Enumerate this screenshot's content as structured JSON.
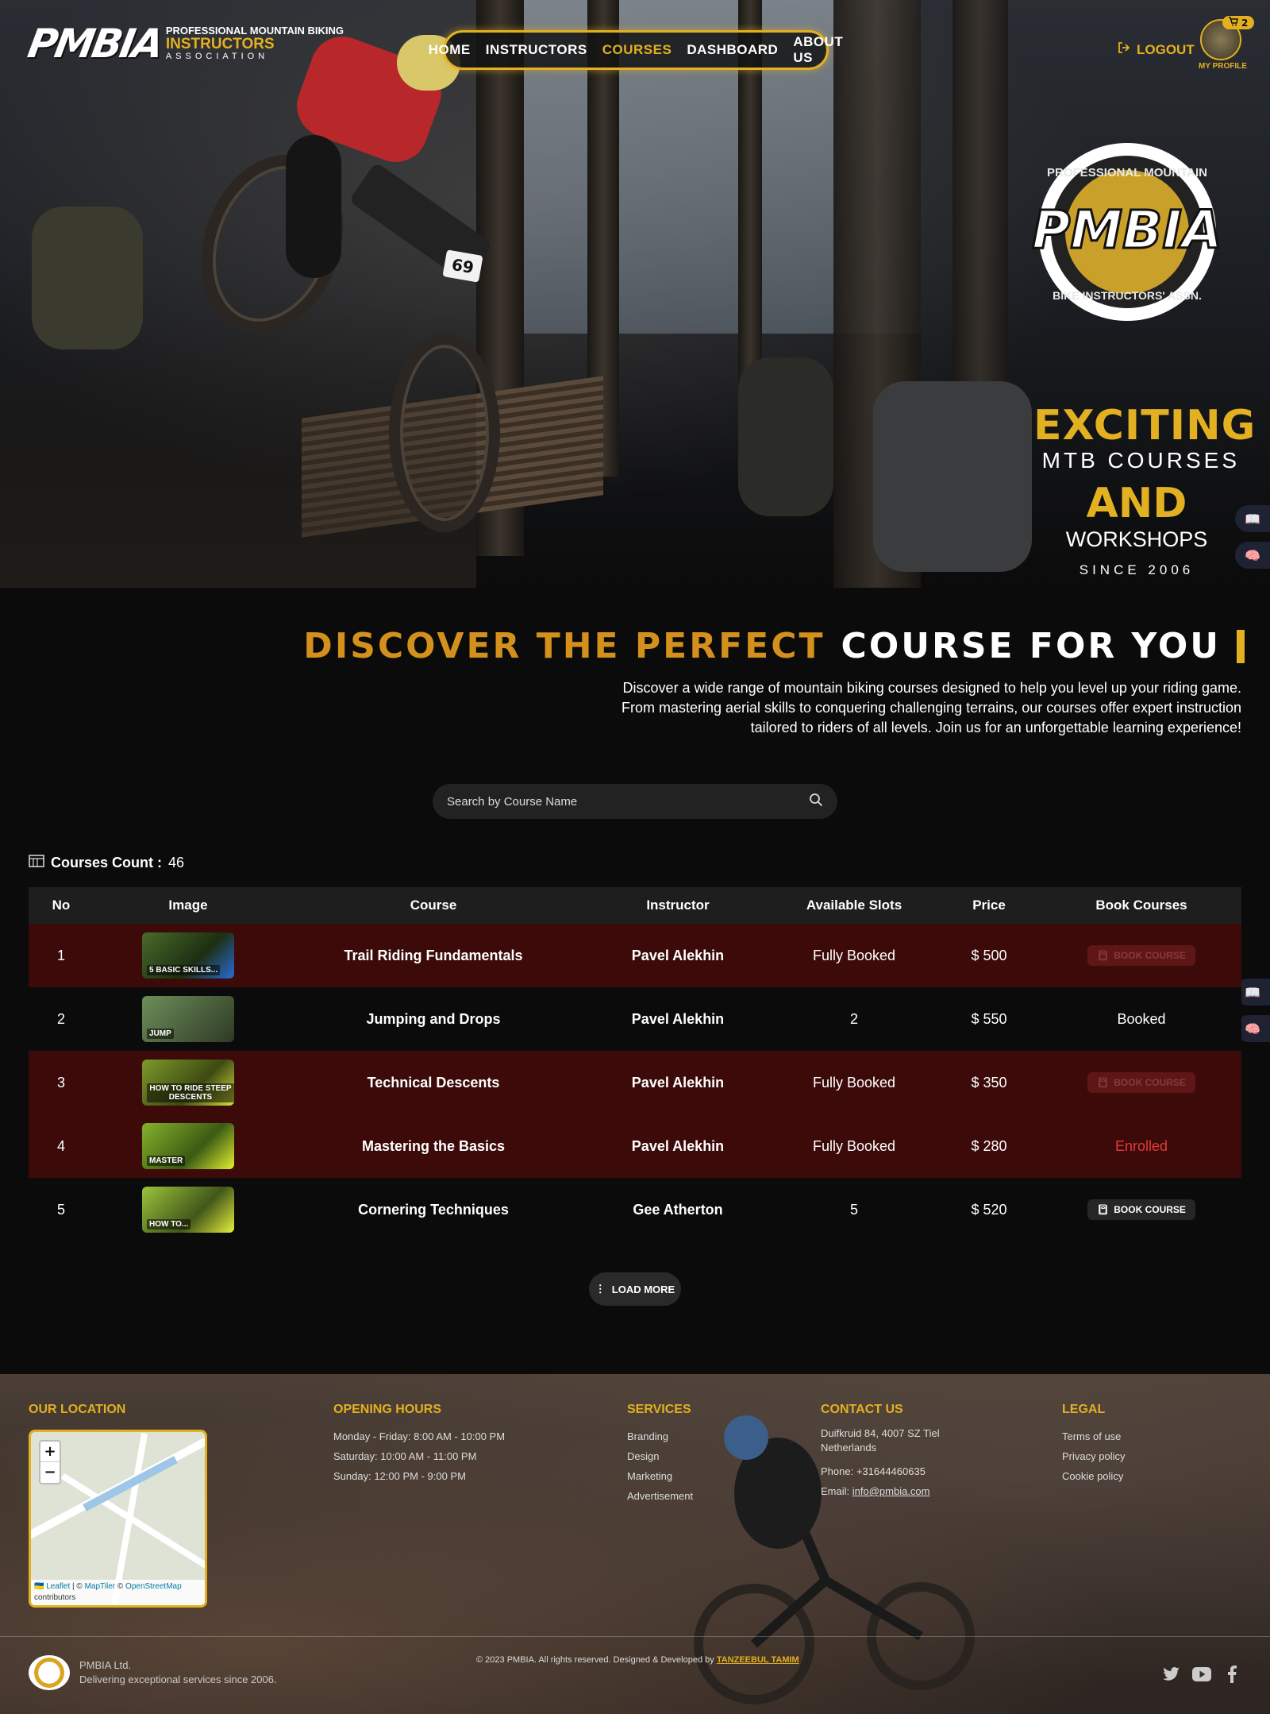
{
  "brand": {
    "logo_mark": "PMBIA",
    "line1": "PROFESSIONAL MOUNTAIN BIKING",
    "line2": "INSTRUCTORS",
    "line3": "ASSOCIATION",
    "accent": "#e3b021"
  },
  "nav": {
    "items": [
      {
        "label": "HOME",
        "active": false
      },
      {
        "label": "INSTRUCTORS",
        "active": false
      },
      {
        "label": "COURSES",
        "active": true
      },
      {
        "label": "DASHBOARD",
        "active": false
      },
      {
        "label": "ABOUT US",
        "active": false
      }
    ]
  },
  "header": {
    "logout_label": "LOGOUT",
    "profile_label": "MY PROFILE",
    "cart_count": "2"
  },
  "hero": {
    "badge_top": "PROFESSIONAL MOUNTAIN",
    "badge_bottom": "BIKE INSTRUCTORS' ASSN.",
    "badge_mark": "PMBIA",
    "rider_number": "69",
    "tagline": {
      "t1": "EXCITING",
      "t2": "MTB COURSES",
      "t3": "AND",
      "t4": "WORKSHOPS",
      "t5": "SINCE 2006"
    }
  },
  "discover": {
    "title_gold": "DISCOVER THE PERFECT",
    "title_white": "COURSE FOR YOU",
    "description": "Discover a wide range of mountain biking courses designed to help you level up your riding game. From mastering aerial skills to conquering challenging terrains, our courses offer expert instruction tailored to riders of all levels. Join us for an unforgettable learning experience!"
  },
  "search": {
    "placeholder": "Search by Course Name",
    "value": ""
  },
  "courses_count": {
    "label": "Courses Count :",
    "value": "46"
  },
  "table": {
    "headers": [
      "No",
      "Image",
      "Course",
      "Instructor",
      "Available Slots",
      "Price",
      "Book Courses"
    ],
    "rows": [
      {
        "no": "1",
        "thumb_text": "5 BASIC SKILLS...",
        "course": "Trail Riding Fundamentals",
        "instructor": "Pavel Alekhin",
        "slots": "Fully Booked",
        "price": "$ 500",
        "book": "BOOK COURSE",
        "book_state": "disabled",
        "highlight": true
      },
      {
        "no": "2",
        "thumb_text": "JUMP",
        "course": "Jumping and Drops",
        "instructor": "Pavel Alekhin",
        "slots": "2",
        "price": "$ 550",
        "book": "Booked",
        "book_state": "text",
        "highlight": false
      },
      {
        "no": "3",
        "thumb_text": "HOW TO RIDE STEEP DESCENTS",
        "course": "Technical Descents",
        "instructor": "Pavel Alekhin",
        "slots": "Fully Booked",
        "price": "$ 350",
        "book": "BOOK COURSE",
        "book_state": "disabled",
        "highlight": true
      },
      {
        "no": "4",
        "thumb_text": "MASTER",
        "course": "Mastering the Basics",
        "instructor": "Pavel Alekhin",
        "slots": "Fully Booked",
        "price": "$ 280",
        "book": "Enrolled",
        "book_state": "enrolled",
        "highlight": true
      },
      {
        "no": "5",
        "thumb_text": "HOW TO...",
        "course": "Cornering Techniques",
        "instructor": "Gee Atherton",
        "slots": "5",
        "price": "$ 520",
        "book": "BOOK COURSE",
        "book_state": "enabled",
        "highlight": false
      }
    ]
  },
  "load_more_label": "LOAD MORE",
  "footer": {
    "location_title": "OUR LOCATION",
    "map_attribution": {
      "leaflet": "Leaflet",
      "sep1": " | © ",
      "maptiler": "MapTiler",
      "sep2": " © ",
      "osm": "OpenStreetMap",
      "tail": "contributors"
    },
    "hours_title": "OPENING HOURS",
    "hours": [
      "Monday - Friday: 8:00 AM - 10:00 PM",
      "Saturday: 10:00 AM - 11:00 PM",
      "Sunday: 12:00 PM - 9:00 PM"
    ],
    "services_title": "SERVICES",
    "services": [
      "Branding",
      "Design",
      "Marketing",
      "Advertisement"
    ],
    "contact_title": "CONTACT US",
    "address": "Duifkruid 84, 4007 SZ Tiel Netherlands",
    "phone": "Phone: +31644460635",
    "email_label": "Email:",
    "email": "info@pmbia.com",
    "legal_title": "LEGAL",
    "legal": [
      "Terms of use",
      "Privacy policy",
      "Cookie policy"
    ],
    "company": "PMBIA Ltd.",
    "company_tag": "Delivering exceptional services since 2006.",
    "copyright": "© 2023 PMBIA. All rights reserved. Designed & Developed by",
    "developer": "TANZEEBUL TAMIM"
  }
}
